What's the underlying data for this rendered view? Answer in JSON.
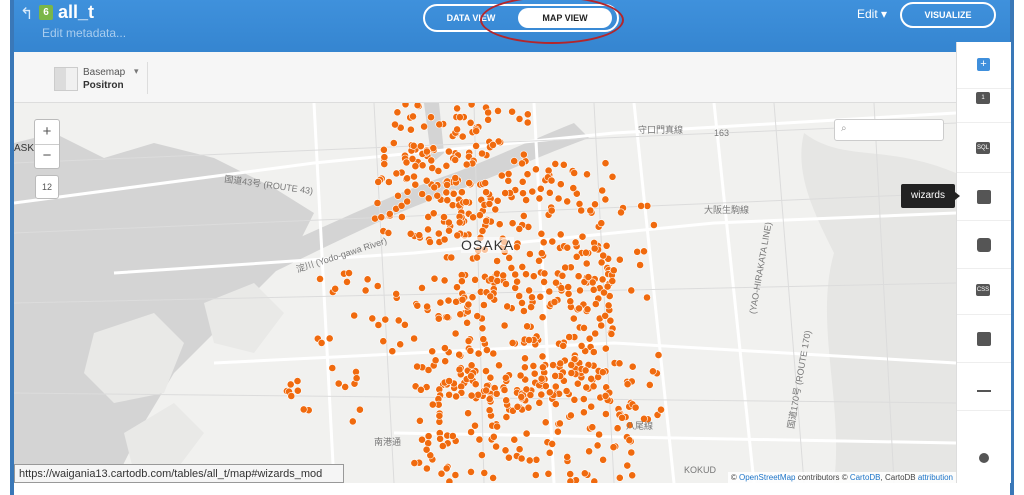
{
  "header": {
    "title": "all_t",
    "table_icon": "6",
    "edit_metadata": "Edit metadata...",
    "data_view": "DATA VIEW",
    "map_view": "MAP VIEW",
    "edit_label": "Edit ▾",
    "visualize_label": "VISUALIZE",
    "back_icon": "↰"
  },
  "basemap": {
    "label": "Basemap",
    "name": "Positron",
    "caret": "▾"
  },
  "map": {
    "zoom_in": "+",
    "zoom_out": "−",
    "zoom_level": "12",
    "city_label": "OSAKA",
    "search_icon": "⌕",
    "labels": {
      "route43": "国道43号 (ROUTE 43)",
      "yodogawa": "淀川 (Yodo-gawa River)",
      "kokudo": "KOKUD",
      "yao": "大阪生駒線",
      "route170": "国道170号 (ROUTE 170)",
      "hirakata": "(YAO-HIRAKATA LINE)",
      "route163": "163",
      "moriguchi": "守口門真線",
      "minami": "南港通",
      "yahata": "八尾線",
      "ask": "ASK"
    },
    "point_color": "#f06a0e",
    "attribution": {
      "prefix": "© ",
      "osm": "OpenStreetMap",
      "mid": " contributors © ",
      "cartodb": "CartoDB",
      "tail": ", CartoDB ",
      "attribution": "attribution"
    }
  },
  "status_url": "https://waigania13.cartodb.com/tables/all_t/map#wizards_mod",
  "tools": {
    "add": "+",
    "layer": "1",
    "sql": "SQL",
    "wizards_tooltip": "wizards",
    "css": "CSS"
  }
}
